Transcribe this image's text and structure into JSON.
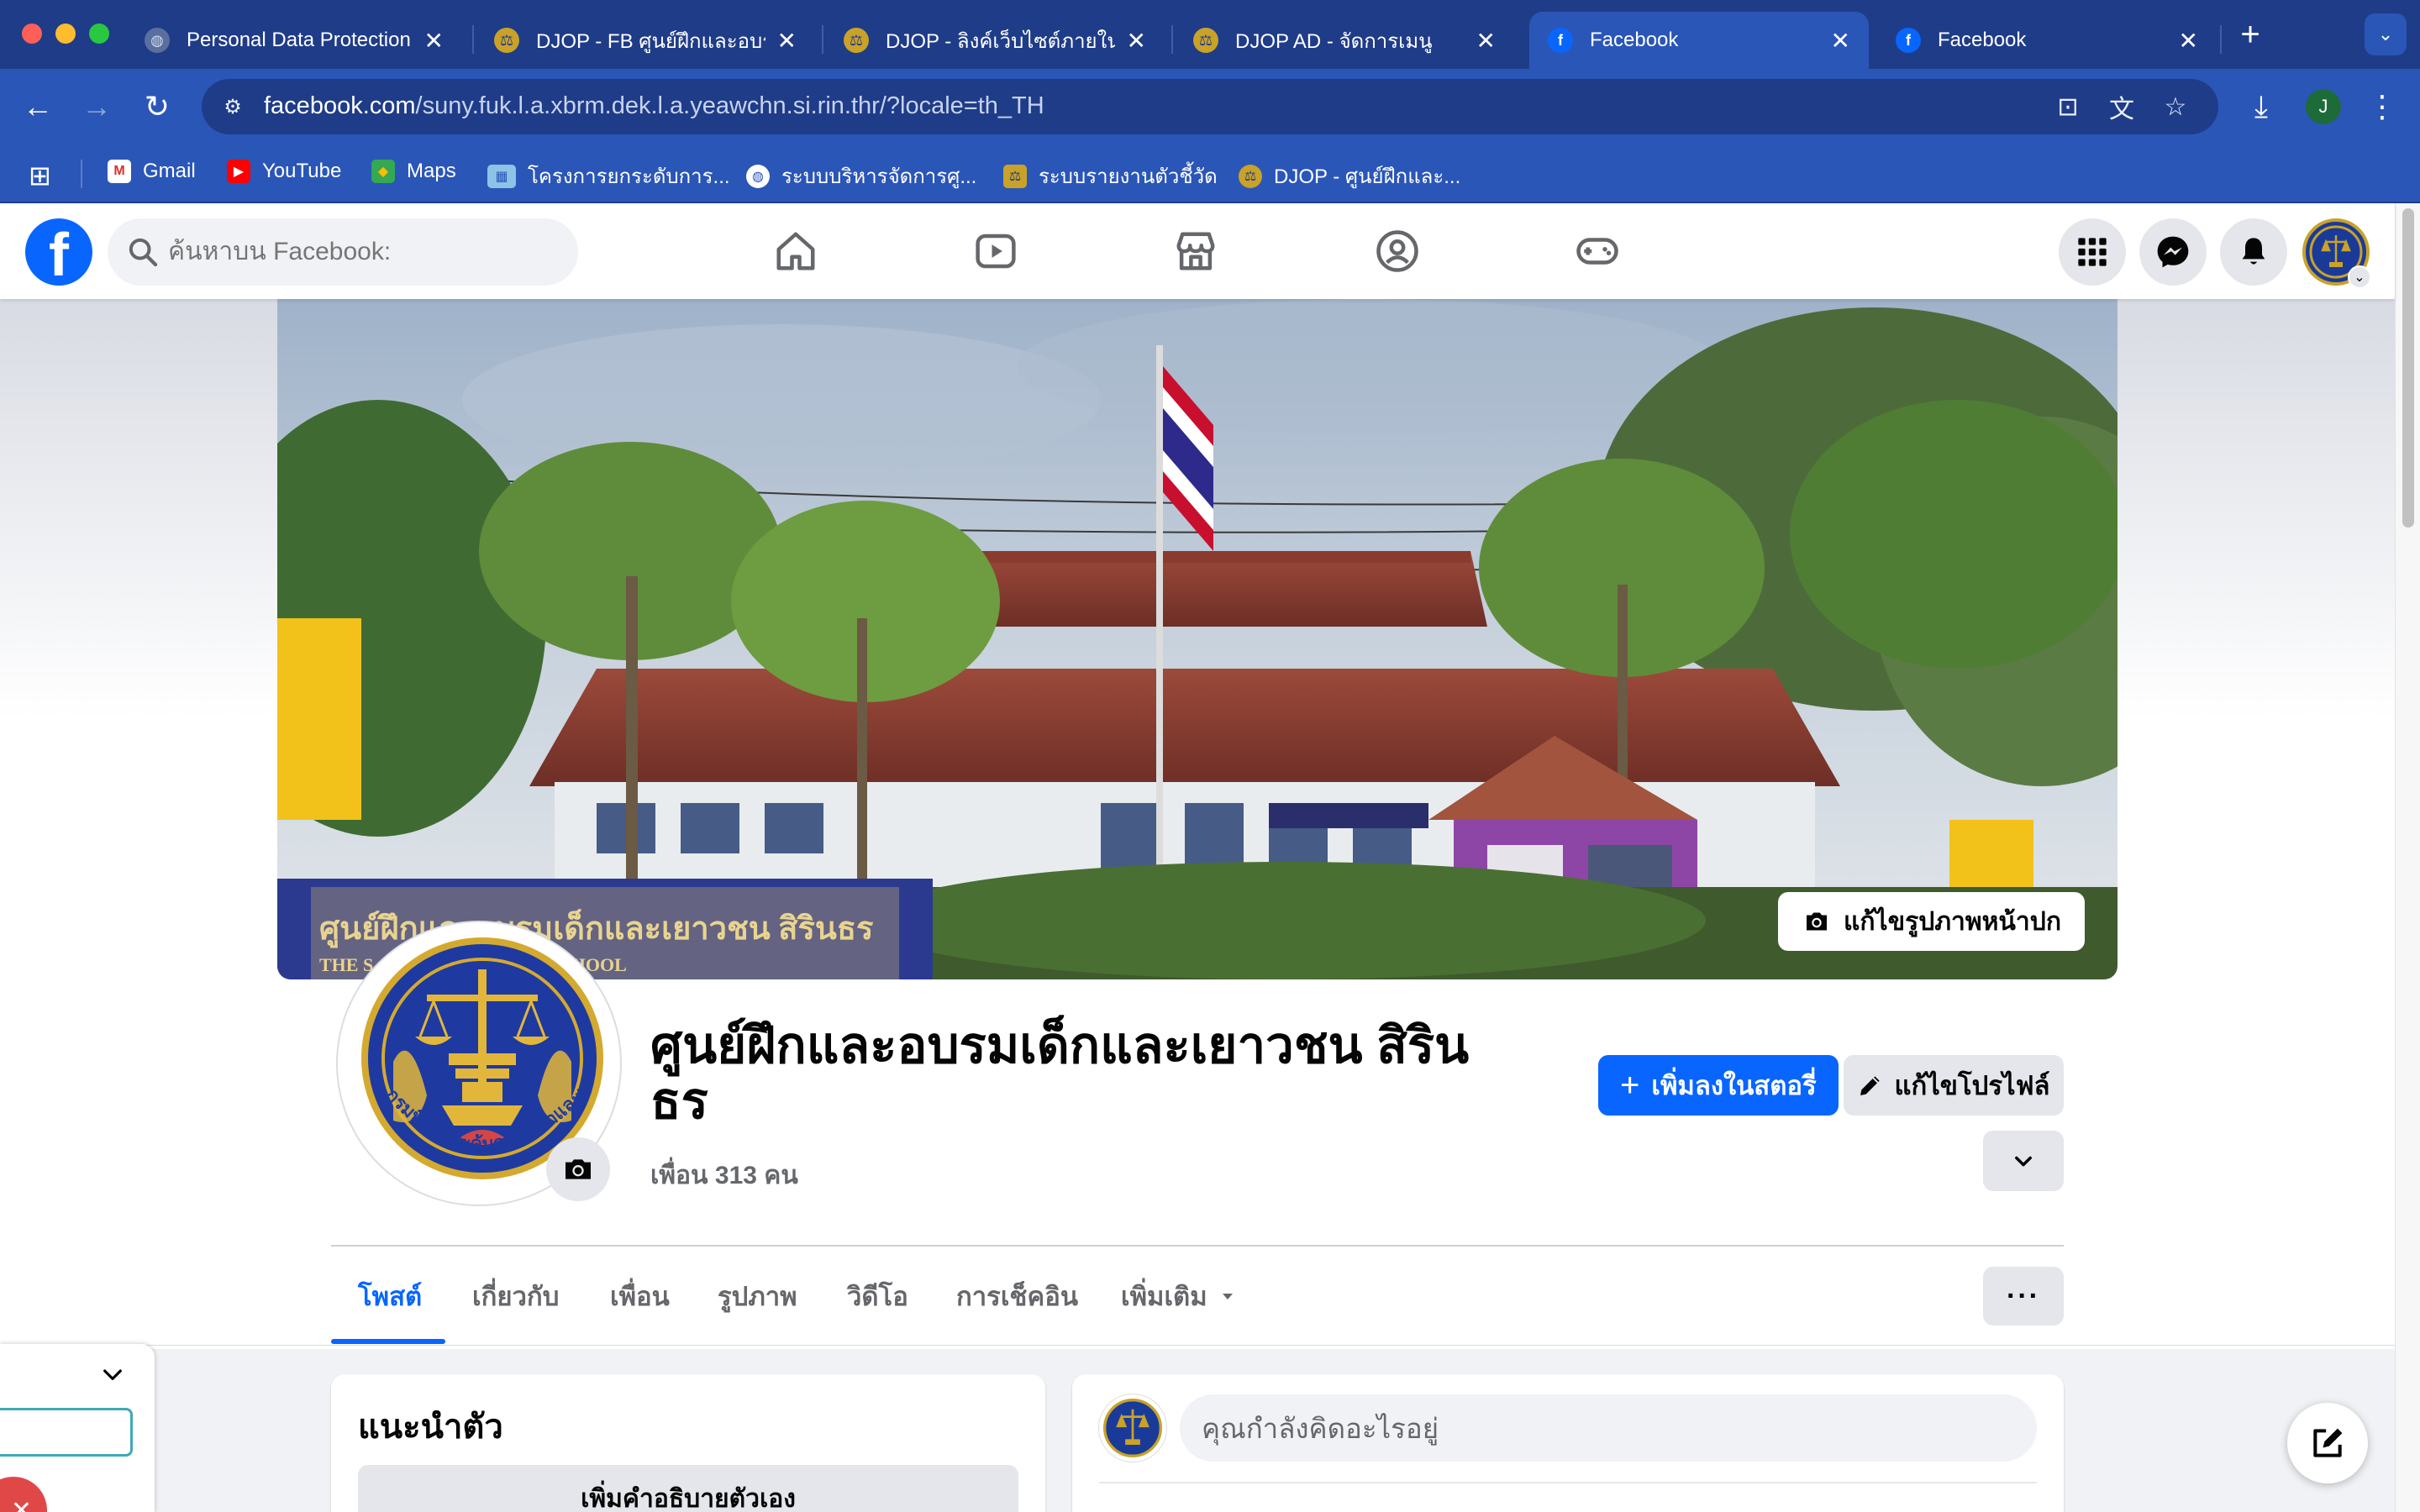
{
  "browser": {
    "tabs": [
      {
        "title": "Personal Data Protection",
        "favicon": "globe-icon"
      },
      {
        "title": "DJOP - FB ศูนย์ฝึกและอบร",
        "favicon": "djop-seal-icon"
      },
      {
        "title": "DJOP - ลิงค์เว็บไซต์ภายใน",
        "favicon": "djop-seal-icon"
      },
      {
        "title": "DJOP AD - จัดการเมนู",
        "favicon": "djop-seal-icon"
      },
      {
        "title": "Facebook",
        "favicon": "facebook-icon",
        "active": true
      },
      {
        "title": "Facebook",
        "favicon": "facebook-icon"
      }
    ],
    "new_tab_symbol": "+",
    "url_host": "facebook.com",
    "url_path": "/suny.fuk.l.a.xbrm.dek.l.a.yeawchn.si.rin.thr/?locale=th_TH",
    "profile_initial": "J",
    "bookmarks": [
      {
        "label": "Gmail",
        "icon": "gmail-icon"
      },
      {
        "label": "YouTube",
        "icon": "youtube-icon"
      },
      {
        "label": "Maps",
        "icon": "maps-icon"
      },
      {
        "label": "โครงการยกระดับการ...",
        "icon": "bookmark-image-icon"
      },
      {
        "label": "ระบบบริหารจัดการศู...",
        "icon": "globe-icon"
      },
      {
        "label": "ระบบรายงานตัวชี้วัด",
        "icon": "djop-seal-icon"
      },
      {
        "label": "DJOP - ศูนย์ฝึกและ...",
        "icon": "djop-seal-icon"
      }
    ]
  },
  "facebook": {
    "search_placeholder": "ค้นหาบน Facebook:",
    "nav": [
      "home-icon",
      "watch-icon",
      "marketplace-icon",
      "groups-icon",
      "gaming-icon"
    ],
    "cover_edit_label": "แก้ไขรูปภาพหน้าปก",
    "profile": {
      "name": "ศูนย์ฝึกและอบรมเด็กและเยาวชน สิรินธร",
      "friends": "เพื่อน 313 คน"
    },
    "cover_sign": {
      "line1": "ศูนย์ฝึกและอบรมเด็กและเยาวชน สิรินธร",
      "line2": "THE S... ONAL TRAINING SCHOOL"
    },
    "seal_text": "กรมพินิจและคุ้มครองเด็กและเยาวชน",
    "actions": {
      "add_story": "เพิ่มลงในสตอรี่",
      "edit_profile": "แก้ไขโปรไฟล์"
    },
    "tabs": [
      "โพสต์",
      "เกี่ยวกับ",
      "เพื่อน",
      "รูปภาพ",
      "วิดีโอ",
      "การเช็คอิน",
      "เพิ่มเติม"
    ],
    "more_symbol": "···",
    "intro": {
      "title": "แนะนำตัว",
      "add_bio": "เพิ่มคำอธิบายตัวเอง"
    },
    "composer_placeholder": "คุณกำลังคิดอะไรอยู่",
    "colors": {
      "brand": "#0866ff",
      "chrome": "#1f3c88",
      "chrome_light": "#2a56b8"
    }
  }
}
